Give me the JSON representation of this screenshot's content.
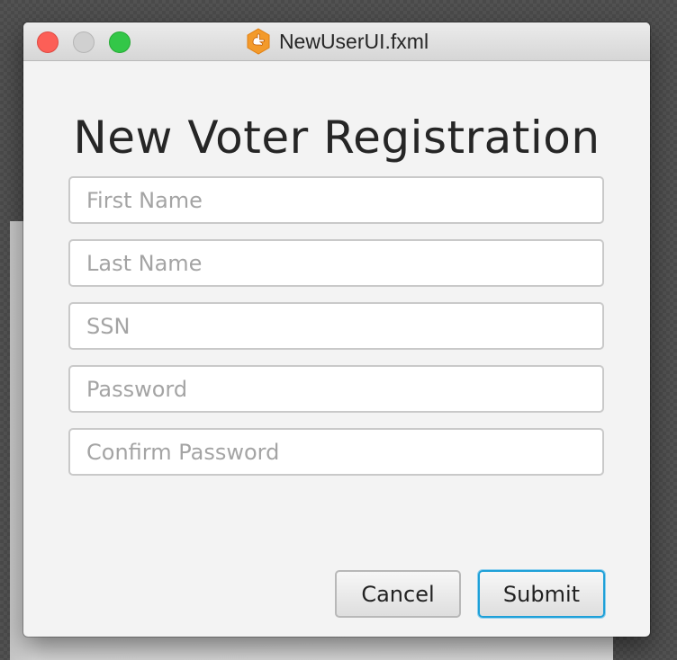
{
  "window": {
    "title": "NewUserUI.fxml",
    "app_icon": "app-hand-icon"
  },
  "form": {
    "heading": "New Voter Registration",
    "fields": {
      "first_name": {
        "placeholder": "First Name",
        "value": ""
      },
      "last_name": {
        "placeholder": "Last Name",
        "value": ""
      },
      "ssn": {
        "placeholder": "SSN",
        "value": ""
      },
      "password": {
        "placeholder": "Password",
        "value": ""
      },
      "confirm_password": {
        "placeholder": "Confirm Password",
        "value": ""
      }
    }
  },
  "buttons": {
    "cancel": "Cancel",
    "submit": "Submit"
  },
  "colors": {
    "close": "#fc5f57",
    "minimize": "#d0d0d0",
    "zoom": "#33c748",
    "focus_accent": "#1ea0d8"
  }
}
